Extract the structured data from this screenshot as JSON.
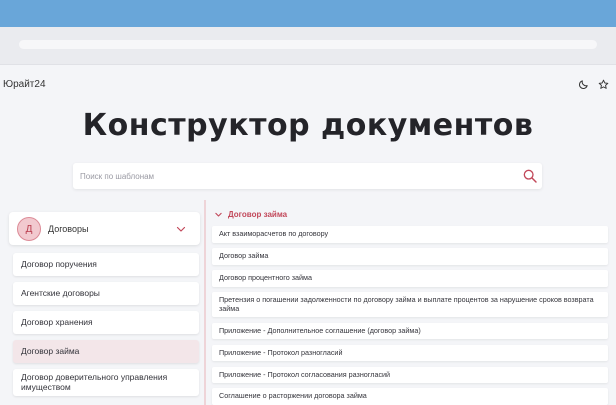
{
  "app": {
    "logo": "Юрайт24"
  },
  "header": {
    "moon_icon": "moon-icon",
    "star_icon": "star-icon"
  },
  "page": {
    "title": "Конструктор документов"
  },
  "search": {
    "placeholder": "Поиск по шаблонам",
    "value": "",
    "icon": "search-icon"
  },
  "category": {
    "avatar_letter": "Д",
    "label": "Договоры",
    "expanded": true
  },
  "categories": [
    {
      "label": "Договор поручения",
      "active": false
    },
    {
      "label": "Агентские договоры",
      "active": false
    },
    {
      "label": "Договор хранения",
      "active": false
    },
    {
      "label": "Договор займа",
      "active": true
    },
    {
      "label": "Договор доверительного управления имуществом",
      "active": false
    }
  ],
  "section": {
    "title": "Договор займа"
  },
  "documents": [
    "Акт взаиморасчетов по договору",
    "Договор займа",
    "Договор процентного займа",
    "Претензия о погашении задолженности по договору займа и выплате процентов за нарушение сроков возврата займа",
    "Приложение - Дополнительное соглашение (договор займа)",
    "Приложение - Протокол разногласий",
    "Приложение - Протокол согласования разногласий",
    "Соглашение о расторжении договора займа"
  ],
  "colors": {
    "accent": "#c2485a",
    "top_band": "#69a6d9",
    "avatar_bg": "#f2c9cf",
    "active_item_bg": "#f3e6e9"
  }
}
